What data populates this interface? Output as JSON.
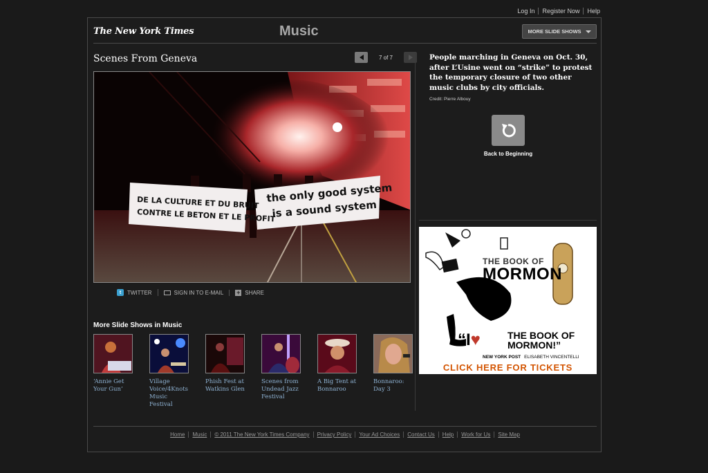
{
  "top_links": [
    "Log In",
    "Register Now",
    "Help"
  ],
  "header": {
    "logo": "The New York Times",
    "section": "Music",
    "more_button": "MORE SLIDE SHOWS"
  },
  "slideshow": {
    "title": "Scenes From Geneva",
    "pager": "7 of 7",
    "banner_left": "DE LA CULTURE ET DU BRUIT CONTRE LE BETON ET LE PROFIT",
    "banner_right": "the only good system is a sound system"
  },
  "share": {
    "twitter": "TWITTER",
    "email": "SIGN IN TO E-MAIL",
    "share": "SHARE"
  },
  "caption": {
    "text": "People marching in Geneva  on Oct. 30, after L’Usine  went on “strike” to protest the temporary closure of two other music clubs by city officials.",
    "credit": "Credit: Pierre Albouy",
    "back_label": "Back to Beginning"
  },
  "more_shows": {
    "heading": "More Slide Shows in Music",
    "items": [
      {
        "caption": "‘Annie Get Your Gun’"
      },
      {
        "caption": "Village Voice/4Knots Music Festival"
      },
      {
        "caption": "Phish Fest at Watkins Glen"
      },
      {
        "caption": "Scenes from Undead Jazz Festival"
      },
      {
        "caption": "A Big Tent at Bonnaroo"
      },
      {
        "caption": "Bonnaroo: Day 3"
      }
    ]
  },
  "ad": {
    "book_of": "THE BOOK OF",
    "mormon": "MORMON",
    "love_i": "“I",
    "heart": "♥",
    "book_title": "THE BOOK OF MORMON!”",
    "quote_source": "NEW YORK POST",
    "quote_author": "ELISABETH VINCENTELLI",
    "cta": "CLICK HERE FOR TICKETS"
  },
  "footer": [
    "Home",
    "Music",
    "© 2011 The New York Times Company",
    "Privacy Policy",
    "Your Ad Choices",
    "Contact Us",
    "Help",
    "Work for Us",
    "Site Map"
  ],
  "colors": {
    "background": "#1a1a1a",
    "link_blue": "#8fb3d4",
    "ad_cta": "#d35400"
  }
}
